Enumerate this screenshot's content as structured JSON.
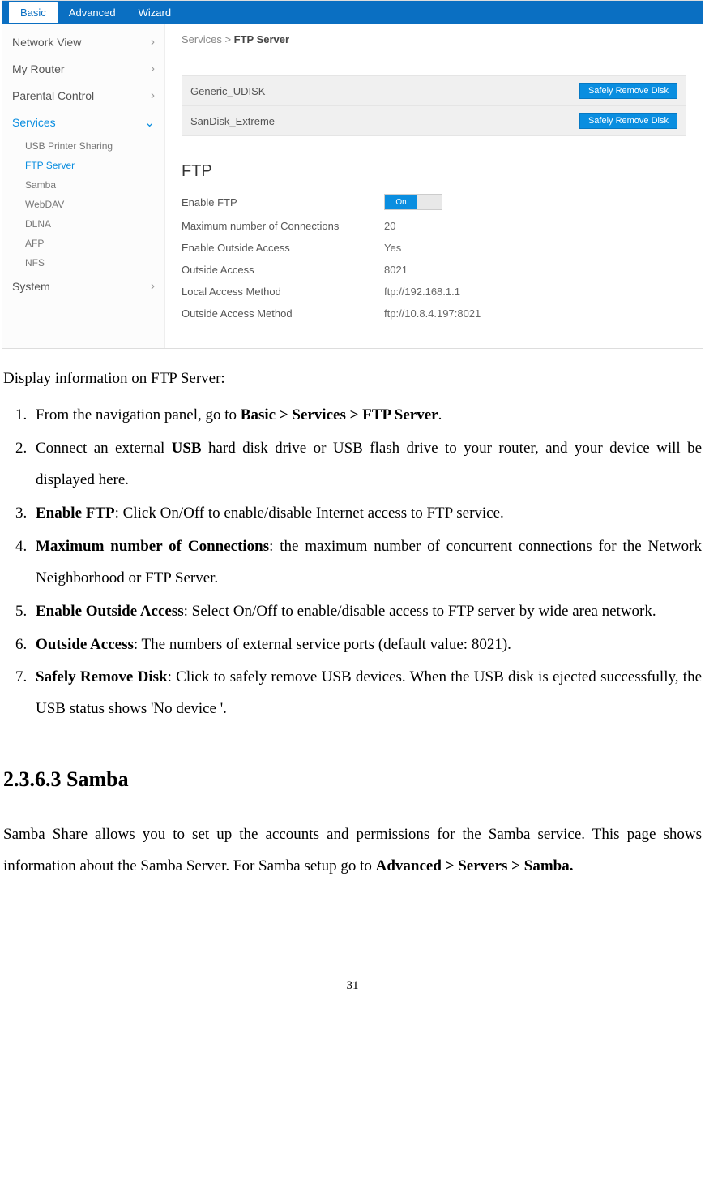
{
  "topTabs": [
    "Basic",
    "Advanced",
    "Wizard"
  ],
  "sidebar": {
    "items": [
      {
        "label": "Network View",
        "chev": "›"
      },
      {
        "label": "My Router",
        "chev": "›"
      },
      {
        "label": "Parental Control",
        "chev": "›"
      },
      {
        "label": "Services",
        "chev": "⌄",
        "active": true
      },
      {
        "label": "System",
        "chev": "›"
      }
    ],
    "subItems": [
      "USB Printer Sharing",
      "FTP Server",
      "Samba",
      "WebDAV",
      "DLNA",
      "AFP",
      "NFS"
    ]
  },
  "breadcrumb": {
    "parent": "Services > ",
    "current": "FTP Server"
  },
  "disks": [
    {
      "name": "Generic_UDISK",
      "btn": "Safely Remove Disk"
    },
    {
      "name": "SanDisk_Extreme",
      "btn": "Safely Remove Disk"
    }
  ],
  "ftp": {
    "title": "FTP",
    "rows": [
      {
        "label": "Enable FTP",
        "toggle": "On"
      },
      {
        "label": "Maximum number of Connections",
        "value": "20"
      },
      {
        "label": "Enable Outside Access",
        "value": "Yes"
      },
      {
        "label": "Outside Access",
        "value": "8021"
      },
      {
        "label": "Local Access Method",
        "value": "ftp://192.168.1.1"
      },
      {
        "label": "Outside Access Method",
        "value": "ftp://10.8.4.197:8021"
      }
    ]
  },
  "doc": {
    "intro": "Display information on FTP Server:",
    "steps": [
      {
        "pre": "From the navigation panel, go to ",
        "b": "Basic > Services > FTP Server",
        "post": "."
      },
      {
        "pre": "Connect an external ",
        "b": "USB",
        "post": " hard disk drive or USB flash drive to your router, and your device will be displayed here."
      },
      {
        "b": "Enable FTP",
        "post": ": Click On/Off to enable/disable Internet access to FTP service."
      },
      {
        "b": "Maximum number of Connections",
        "post": ": the maximum number of concurrent connections for the Network Neighborhood or FTP Server."
      },
      {
        "b": "Enable Outside Access",
        "post": ": Select On/Off to enable/disable access to FTP server by wide area network."
      },
      {
        "b": "Outside Access",
        "post": ": The numbers of external service ports (default value: 8021)."
      },
      {
        "b": "Safely Remove Disk",
        "post": ": Click to safely remove USB devices. When the USB disk is ejected successfully, the USB status shows 'No device '."
      }
    ],
    "h2": "2.3.6.3 Samba",
    "samba": {
      "pre": "Samba Share allows you to set up the accounts and permissions for the Samba service. This page shows information about the Samba Server. For Samba setup go to ",
      "b": "Advanced > Servers > Samba."
    },
    "pageNum": "31"
  }
}
